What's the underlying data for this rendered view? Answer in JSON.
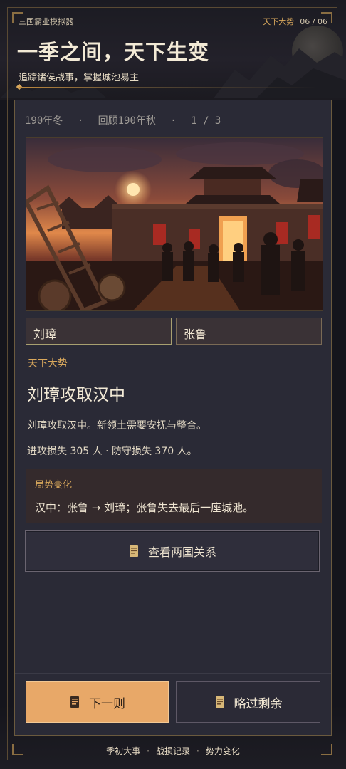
{
  "header": {
    "app_name": "三国霸业模拟器",
    "section_name": "天下大势",
    "page_indicator": "06 / 06",
    "title": "一季之间，天下生变",
    "subtitle": "追踪诸侯战事，掌握城池易主"
  },
  "event": {
    "season": "190年冬",
    "review": "回顾190年秋",
    "counter": "1 / 3",
    "image_icon": "city-siege-illustration",
    "attacker": "刘璋",
    "defender": "张鲁",
    "category": "天下大势",
    "title": "刘璋攻取汉中",
    "description": "刘璋攻取汉中。新领土需要安抚与整合。",
    "losses": "进攻损失 305 人 · 防守损失 370 人。"
  },
  "change": {
    "title": "局势变化",
    "text": "汉中：张鲁 → 刘璋；张鲁失去最后一座城池。"
  },
  "buttons": {
    "relations": "查看两国关系",
    "next": "下一则",
    "skip": "略过剩余"
  },
  "bottom_nav": {
    "items": [
      "季初大事",
      "战损记录",
      "势力变化"
    ]
  },
  "colors": {
    "accent": "#d9a85c",
    "primary_button": "#e8a868",
    "card_bg": "#2a2a36",
    "page_bg": "#15151c"
  }
}
